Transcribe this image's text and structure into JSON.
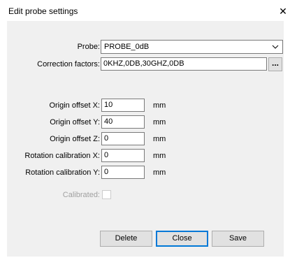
{
  "window": {
    "title": "Edit probe settings",
    "close_glyph": "✕"
  },
  "form": {
    "probe": {
      "label": "Probe:",
      "value": "PROBE_0dB"
    },
    "correction": {
      "label": "Correction factors:",
      "value": "0KHZ,0DB,30GHZ,0DB",
      "browse_label": "..."
    },
    "origin_x": {
      "label": "Origin offset X:",
      "value": "10",
      "unit": "mm"
    },
    "origin_y": {
      "label": "Origin offset Y:",
      "value": "40",
      "unit": "mm"
    },
    "origin_z": {
      "label": "Origin offset Z:",
      "value": "0",
      "unit": "mm"
    },
    "rot_x": {
      "label": "Rotation calibration X:",
      "value": "0",
      "unit": "mm"
    },
    "rot_y": {
      "label": "Rotation calibration Y:",
      "value": "0",
      "unit": "mm"
    },
    "calibrated": {
      "label": "Calibrated:",
      "checked": false,
      "enabled": false
    }
  },
  "buttons": {
    "delete": "Delete",
    "close": "Close",
    "save": "Save"
  },
  "icons": {
    "dropdown": "chevron-down-icon",
    "close": "close-icon"
  }
}
